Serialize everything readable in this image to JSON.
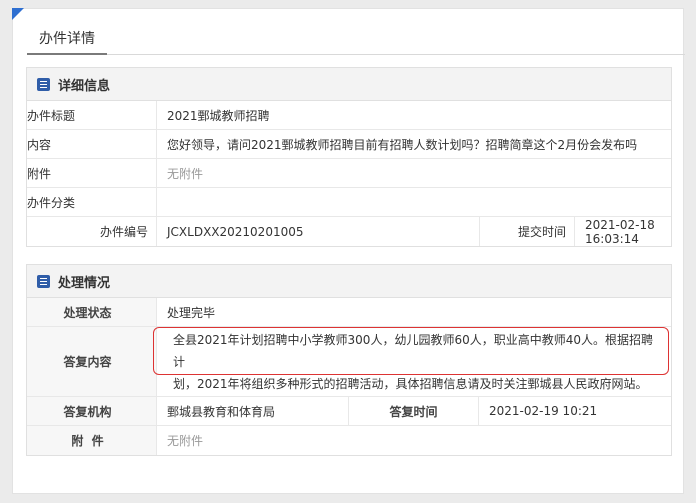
{
  "page": {
    "title": "办件详情"
  },
  "detail": {
    "section_title": "详细信息",
    "rows": [
      {
        "label": "办件标题",
        "value": "2021鄄城教师招聘"
      },
      {
        "label": "内容",
        "value": "您好领导，请问2021鄄城教师招聘目前有招聘人数计划吗？招聘简章这个2月份会发布吗"
      },
      {
        "label": "附件",
        "value": "无附件"
      },
      {
        "label": "办件分类",
        "value": ""
      }
    ],
    "number_label": "办件编号",
    "number_value": "JCXLDXX20210201005",
    "submit_label": "提交时间",
    "submit_value": "2021-02-18 16:03:14"
  },
  "handling": {
    "section_title": "处理情况",
    "status_label": "处理状态",
    "status_value": "处理完毕",
    "reply_label": "答复内容",
    "reply_line1": "全县2021年计划招聘中小学教师300人，幼儿园教师60人，职业高中教师40人。根据招聘计",
    "reply_line2": "划，2021年将组织多种形式的招聘活动，具体招聘信息请及时关注鄄城县人民政府网站。",
    "org_label": "答复机构",
    "org_value": "鄄城县教育和体育局",
    "time_label": "答复时间",
    "time_value": "2021-02-19 10:21",
    "attach_label": "附  件",
    "attach_value": "无附件"
  },
  "colors": {
    "accent": "#2e6fd1",
    "highlight_border": "#dd3333"
  }
}
